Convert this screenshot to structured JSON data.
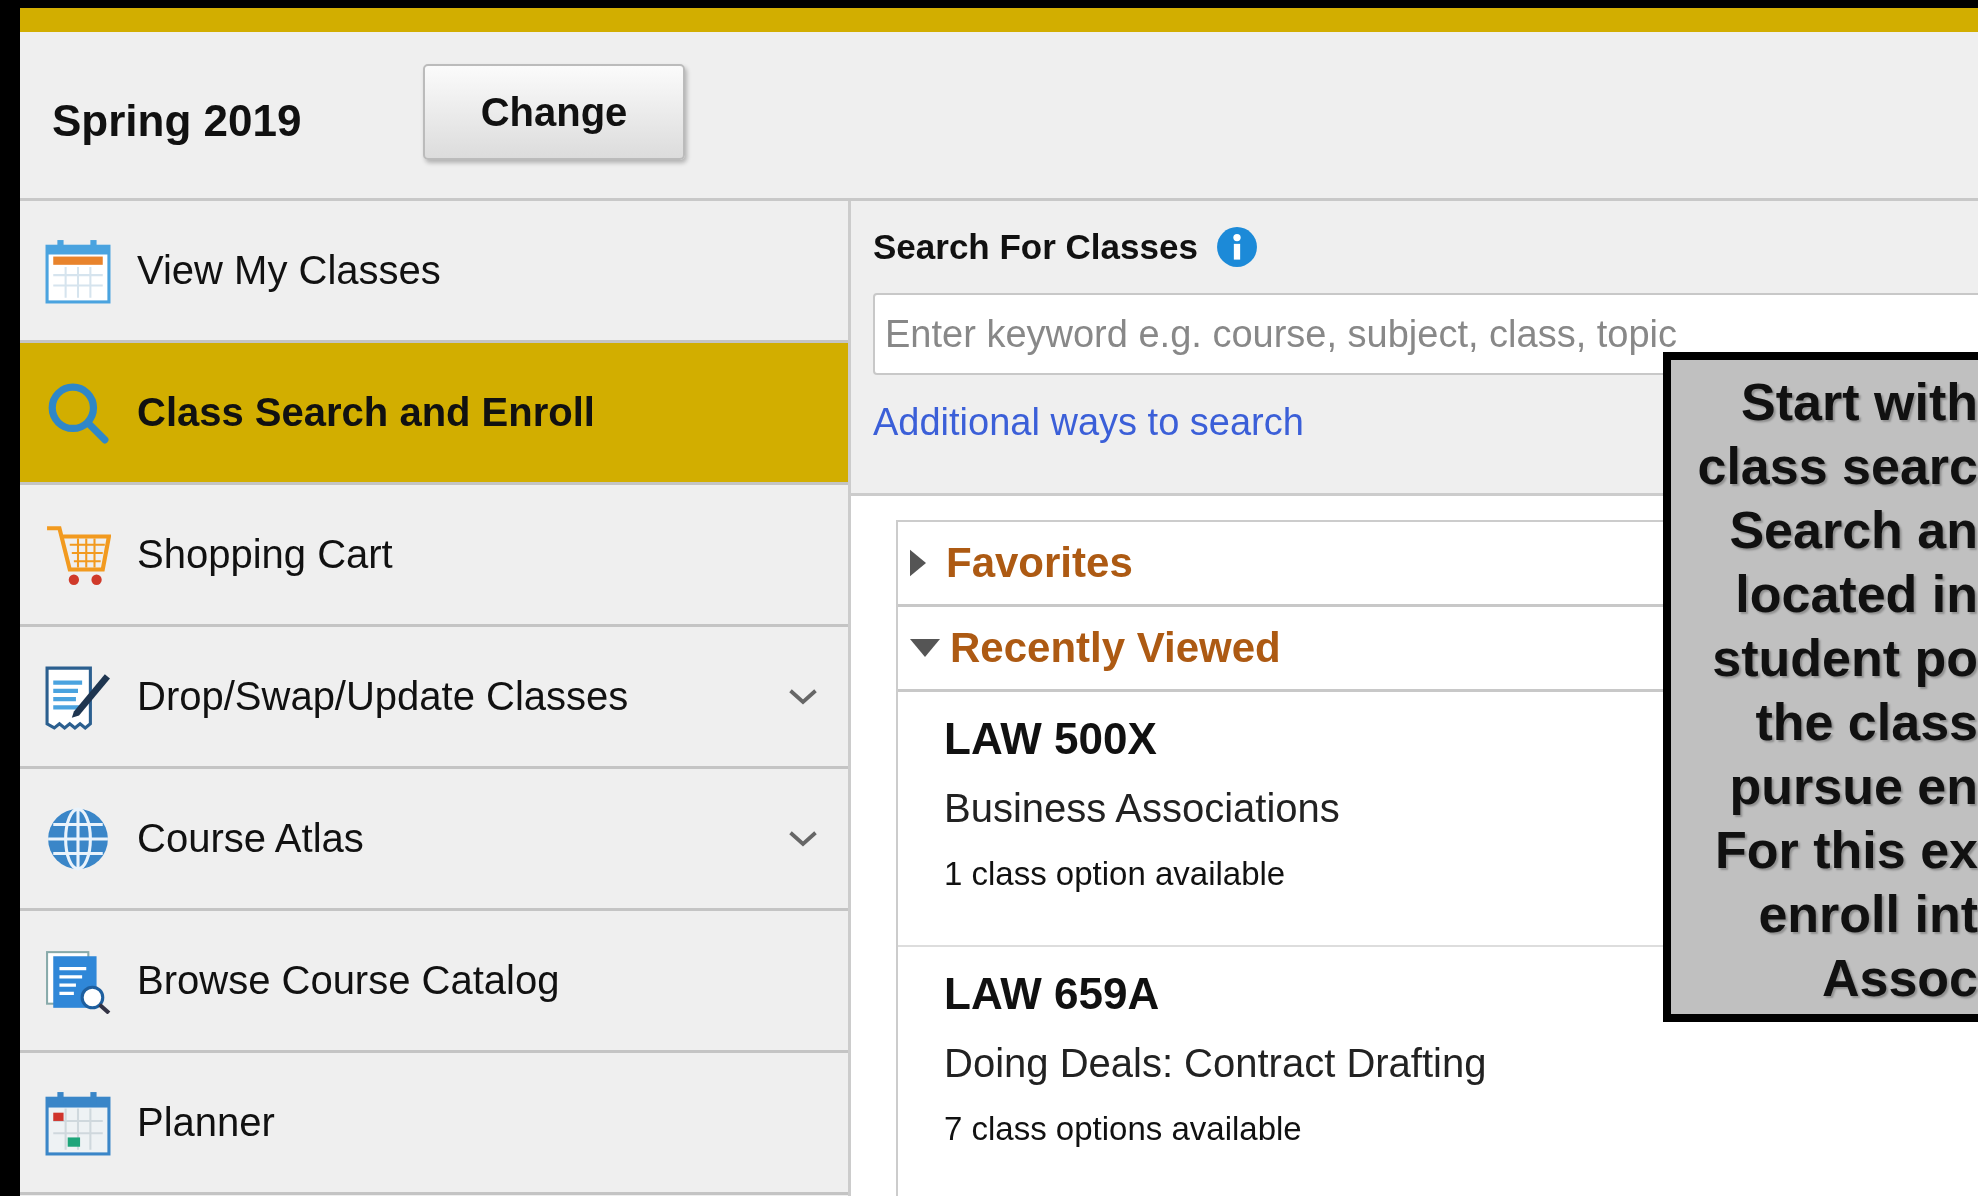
{
  "term": {
    "label": "Spring 2019",
    "button": "Change"
  },
  "sidebar": {
    "items": [
      {
        "kind": "calendar",
        "label": "View My Classes",
        "selected": false,
        "expandable": false
      },
      {
        "kind": "search",
        "label": "Class Search and Enroll",
        "selected": true,
        "expandable": false
      },
      {
        "kind": "cart",
        "label": "Shopping Cart",
        "selected": false,
        "expandable": false
      },
      {
        "kind": "edit",
        "label": "Drop/Swap/Update Classes",
        "selected": false,
        "expandable": true
      },
      {
        "kind": "globe",
        "label": "Course Atlas",
        "selected": false,
        "expandable": true
      },
      {
        "kind": "catalog",
        "label": "Browse Course Catalog",
        "selected": false,
        "expandable": false
      },
      {
        "kind": "planner",
        "label": "Planner",
        "selected": false,
        "expandable": false
      }
    ]
  },
  "search": {
    "title": "Search For Classes",
    "placeholder": "Enter keyword e.g. course, subject, class, topic",
    "link": "Additional ways to search"
  },
  "sections": [
    {
      "label": "Favorites",
      "expanded": false
    },
    {
      "label": "Recently Viewed",
      "expanded": true
    }
  ],
  "recent": [
    {
      "code": "LAW 500X",
      "title": "Business Associations",
      "options": "1 class option available"
    },
    {
      "code": "LAW 659A",
      "title": "Doing Deals: Contract Drafting",
      "options": "7 class options available"
    }
  ],
  "callout": {
    "lines": [
      "Start with",
      "class searc",
      "Search an",
      "located in",
      "student po",
      "the class",
      "pursue en",
      "For this ex",
      "enroll int",
      "Assoc"
    ]
  }
}
